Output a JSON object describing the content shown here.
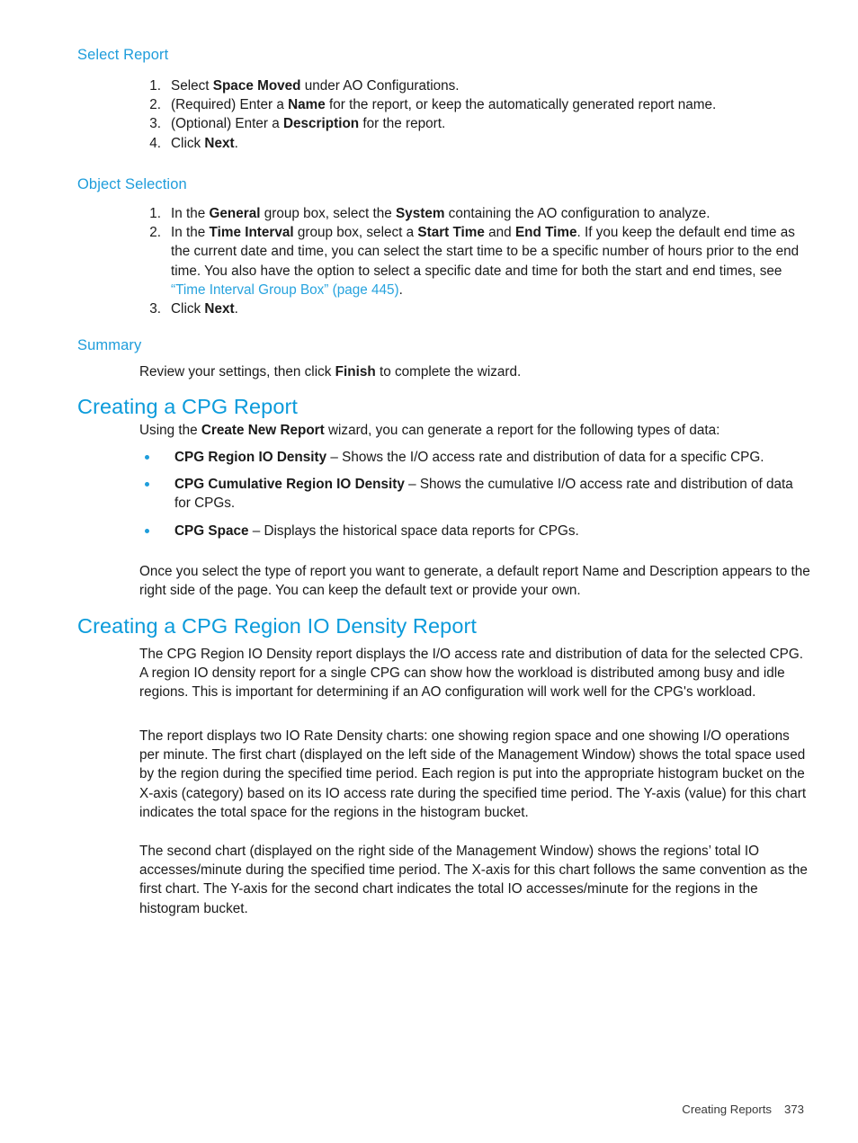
{
  "document": {
    "footer": {
      "section_label": "Creating Reports",
      "page_number": "373"
    },
    "accent_color": "#0b9bdb",
    "link_color": "#27a3de"
  },
  "sections": {
    "select_report": {
      "heading": "Select Report",
      "steps": [
        {
          "num": "1.",
          "pre": "Select ",
          "bold": "Space Moved",
          "post": " under AO Configurations."
        },
        {
          "num": "2.",
          "pre": "(Required) Enter a ",
          "bold": "Name",
          "post": " for the report, or keep the automatically generated report name."
        },
        {
          "num": "3.",
          "pre": "(Optional) Enter a ",
          "bold": "Description",
          "post": " for the report."
        },
        {
          "num": "4.",
          "pre": "Click ",
          "bold": "Next",
          "post": "."
        }
      ]
    },
    "object_selection": {
      "heading": "Object Selection",
      "steps": [
        {
          "num": "1.",
          "t1": "In the ",
          "b1": "General",
          "t2": " group box, select the ",
          "b2": "System",
          "t3": " containing the AO configuration to analyze."
        },
        {
          "num": "2.",
          "t1": "In the ",
          "b1": "Time Interval",
          "t2": " group box, select a ",
          "b2": "Start Time",
          "t3": " and ",
          "b3": "End Time",
          "t4": ". If you keep the default end time as the current date and time, you can select the start time to be a specific number of hours prior to the end time. You also have the option to select a specific date and time for both the start and end times, see ",
          "link": "“Time Interval Group Box” (page 445)",
          "t5": "."
        },
        {
          "num": "3.",
          "t1": "Click ",
          "b1": "Next",
          "t2": "."
        }
      ]
    },
    "summary": {
      "heading": "Summary",
      "paragraph": {
        "pre": "Review your settings, then click ",
        "bold": "Finish",
        "post": " to complete the wizard."
      }
    },
    "creating_cpg_report": {
      "heading": "Creating a CPG Report",
      "intro": {
        "pre": "Using the ",
        "bold": "Create New Report",
        "post": " wizard, you can generate a report for the following types of data:"
      },
      "bullets": [
        {
          "term": "CPG Region IO Density",
          "definition": " – Shows the I/O access rate and distribution of data for a specific CPG."
        },
        {
          "term": "CPG Cumulative Region IO Density",
          "definition": " – Shows the cumulative I/O access rate and distribution of data for CPGs."
        },
        {
          "term": "CPG Space",
          "definition": " – Displays the historical space data reports for CPGs."
        }
      ],
      "closing": "Once you select the type of report you want to generate, a default report Name and Description appears to the right side of the page. You can keep the default text or provide your own."
    },
    "creating_cpg_region_io_density_report": {
      "heading": "Creating a CPG Region IO Density Report",
      "paragraphs": [
        "The CPG Region IO Density report displays the I/O access rate and distribution of data for the selected CPG. A region IO density report for a single CPG can show how the workload is distributed among busy and idle regions. This is important for determining if an AO configuration will work well for the CPG's workload.",
        "The report displays two IO Rate Density charts: one showing region space and one showing I/O operations per minute. The first chart (displayed on the left side of the Management Window) shows the total space used by the region during the specified time period. Each region is put into the appropriate histogram bucket on the X-axis (category) based on its IO access rate during the specified time period. The Y-axis (value) for this chart indicates the total space for the regions in the histogram bucket.",
        "The second chart (displayed on the right side of the Management Window) shows the regions’ total IO accesses/minute during the specified time period. The X-axis for this chart follows the same convention as the first chart. The Y-axis for the second chart indicates the total IO accesses/minute for the regions in the histogram bucket."
      ]
    }
  }
}
